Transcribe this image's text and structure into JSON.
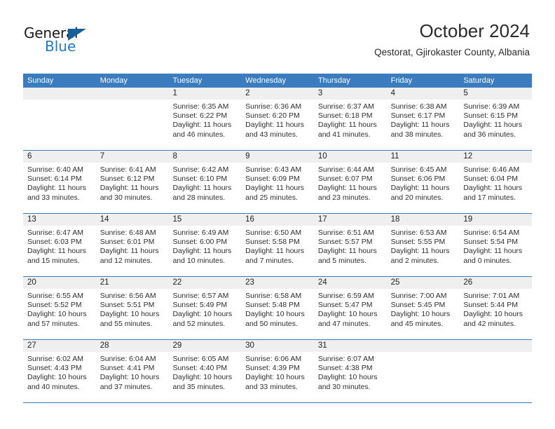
{
  "logo": {
    "word1": "General",
    "word2": "Blue",
    "triangle_color": "#14619d",
    "blue_color": "#1e7bc4"
  },
  "header": {
    "title": "October 2024",
    "subtitle": "Qestorat, Gjirokaster County, Albania"
  },
  "theme": {
    "header_blue": "#3a7cbe",
    "daynum_bg": "#efefef",
    "text": "#2e2e2e"
  },
  "weekdays": [
    "Sunday",
    "Monday",
    "Tuesday",
    "Wednesday",
    "Thursday",
    "Friday",
    "Saturday"
  ],
  "weeks": [
    [
      {
        "day": "",
        "lines": []
      },
      {
        "day": "",
        "lines": []
      },
      {
        "day": "1",
        "lines": [
          "Sunrise: 6:35 AM",
          "Sunset: 6:22 PM",
          "Daylight: 11 hours",
          "and 46 minutes."
        ]
      },
      {
        "day": "2",
        "lines": [
          "Sunrise: 6:36 AM",
          "Sunset: 6:20 PM",
          "Daylight: 11 hours",
          "and 43 minutes."
        ]
      },
      {
        "day": "3",
        "lines": [
          "Sunrise: 6:37 AM",
          "Sunset: 6:18 PM",
          "Daylight: 11 hours",
          "and 41 minutes."
        ]
      },
      {
        "day": "4",
        "lines": [
          "Sunrise: 6:38 AM",
          "Sunset: 6:17 PM",
          "Daylight: 11 hours",
          "and 38 minutes."
        ]
      },
      {
        "day": "5",
        "lines": [
          "Sunrise: 6:39 AM",
          "Sunset: 6:15 PM",
          "Daylight: 11 hours",
          "and 36 minutes."
        ]
      }
    ],
    [
      {
        "day": "6",
        "lines": [
          "Sunrise: 6:40 AM",
          "Sunset: 6:14 PM",
          "Daylight: 11 hours",
          "and 33 minutes."
        ]
      },
      {
        "day": "7",
        "lines": [
          "Sunrise: 6:41 AM",
          "Sunset: 6:12 PM",
          "Daylight: 11 hours",
          "and 30 minutes."
        ]
      },
      {
        "day": "8",
        "lines": [
          "Sunrise: 6:42 AM",
          "Sunset: 6:10 PM",
          "Daylight: 11 hours",
          "and 28 minutes."
        ]
      },
      {
        "day": "9",
        "lines": [
          "Sunrise: 6:43 AM",
          "Sunset: 6:09 PM",
          "Daylight: 11 hours",
          "and 25 minutes."
        ]
      },
      {
        "day": "10",
        "lines": [
          "Sunrise: 6:44 AM",
          "Sunset: 6:07 PM",
          "Daylight: 11 hours",
          "and 23 minutes."
        ]
      },
      {
        "day": "11",
        "lines": [
          "Sunrise: 6:45 AM",
          "Sunset: 6:06 PM",
          "Daylight: 11 hours",
          "and 20 minutes."
        ]
      },
      {
        "day": "12",
        "lines": [
          "Sunrise: 6:46 AM",
          "Sunset: 6:04 PM",
          "Daylight: 11 hours",
          "and 17 minutes."
        ]
      }
    ],
    [
      {
        "day": "13",
        "lines": [
          "Sunrise: 6:47 AM",
          "Sunset: 6:03 PM",
          "Daylight: 11 hours",
          "and 15 minutes."
        ]
      },
      {
        "day": "14",
        "lines": [
          "Sunrise: 6:48 AM",
          "Sunset: 6:01 PM",
          "Daylight: 11 hours",
          "and 12 minutes."
        ]
      },
      {
        "day": "15",
        "lines": [
          "Sunrise: 6:49 AM",
          "Sunset: 6:00 PM",
          "Daylight: 11 hours",
          "and 10 minutes."
        ]
      },
      {
        "day": "16",
        "lines": [
          "Sunrise: 6:50 AM",
          "Sunset: 5:58 PM",
          "Daylight: 11 hours",
          "and 7 minutes."
        ]
      },
      {
        "day": "17",
        "lines": [
          "Sunrise: 6:51 AM",
          "Sunset: 5:57 PM",
          "Daylight: 11 hours",
          "and 5 minutes."
        ]
      },
      {
        "day": "18",
        "lines": [
          "Sunrise: 6:53 AM",
          "Sunset: 5:55 PM",
          "Daylight: 11 hours",
          "and 2 minutes."
        ]
      },
      {
        "day": "19",
        "lines": [
          "Sunrise: 6:54 AM",
          "Sunset: 5:54 PM",
          "Daylight: 11 hours",
          "and 0 minutes."
        ]
      }
    ],
    [
      {
        "day": "20",
        "lines": [
          "Sunrise: 6:55 AM",
          "Sunset: 5:52 PM",
          "Daylight: 10 hours",
          "and 57 minutes."
        ]
      },
      {
        "day": "21",
        "lines": [
          "Sunrise: 6:56 AM",
          "Sunset: 5:51 PM",
          "Daylight: 10 hours",
          "and 55 minutes."
        ]
      },
      {
        "day": "22",
        "lines": [
          "Sunrise: 6:57 AM",
          "Sunset: 5:49 PM",
          "Daylight: 10 hours",
          "and 52 minutes."
        ]
      },
      {
        "day": "23",
        "lines": [
          "Sunrise: 6:58 AM",
          "Sunset: 5:48 PM",
          "Daylight: 10 hours",
          "and 50 minutes."
        ]
      },
      {
        "day": "24",
        "lines": [
          "Sunrise: 6:59 AM",
          "Sunset: 5:47 PM",
          "Daylight: 10 hours",
          "and 47 minutes."
        ]
      },
      {
        "day": "25",
        "lines": [
          "Sunrise: 7:00 AM",
          "Sunset: 5:45 PM",
          "Daylight: 10 hours",
          "and 45 minutes."
        ]
      },
      {
        "day": "26",
        "lines": [
          "Sunrise: 7:01 AM",
          "Sunset: 5:44 PM",
          "Daylight: 10 hours",
          "and 42 minutes."
        ]
      }
    ],
    [
      {
        "day": "27",
        "lines": [
          "Sunrise: 6:02 AM",
          "Sunset: 4:43 PM",
          "Daylight: 10 hours",
          "and 40 minutes."
        ]
      },
      {
        "day": "28",
        "lines": [
          "Sunrise: 6:04 AM",
          "Sunset: 4:41 PM",
          "Daylight: 10 hours",
          "and 37 minutes."
        ]
      },
      {
        "day": "29",
        "lines": [
          "Sunrise: 6:05 AM",
          "Sunset: 4:40 PM",
          "Daylight: 10 hours",
          "and 35 minutes."
        ]
      },
      {
        "day": "30",
        "lines": [
          "Sunrise: 6:06 AM",
          "Sunset: 4:39 PM",
          "Daylight: 10 hours",
          "and 33 minutes."
        ]
      },
      {
        "day": "31",
        "lines": [
          "Sunrise: 6:07 AM",
          "Sunset: 4:38 PM",
          "Daylight: 10 hours",
          "and 30 minutes."
        ]
      },
      {
        "day": "",
        "lines": []
      },
      {
        "day": "",
        "lines": []
      }
    ]
  ]
}
